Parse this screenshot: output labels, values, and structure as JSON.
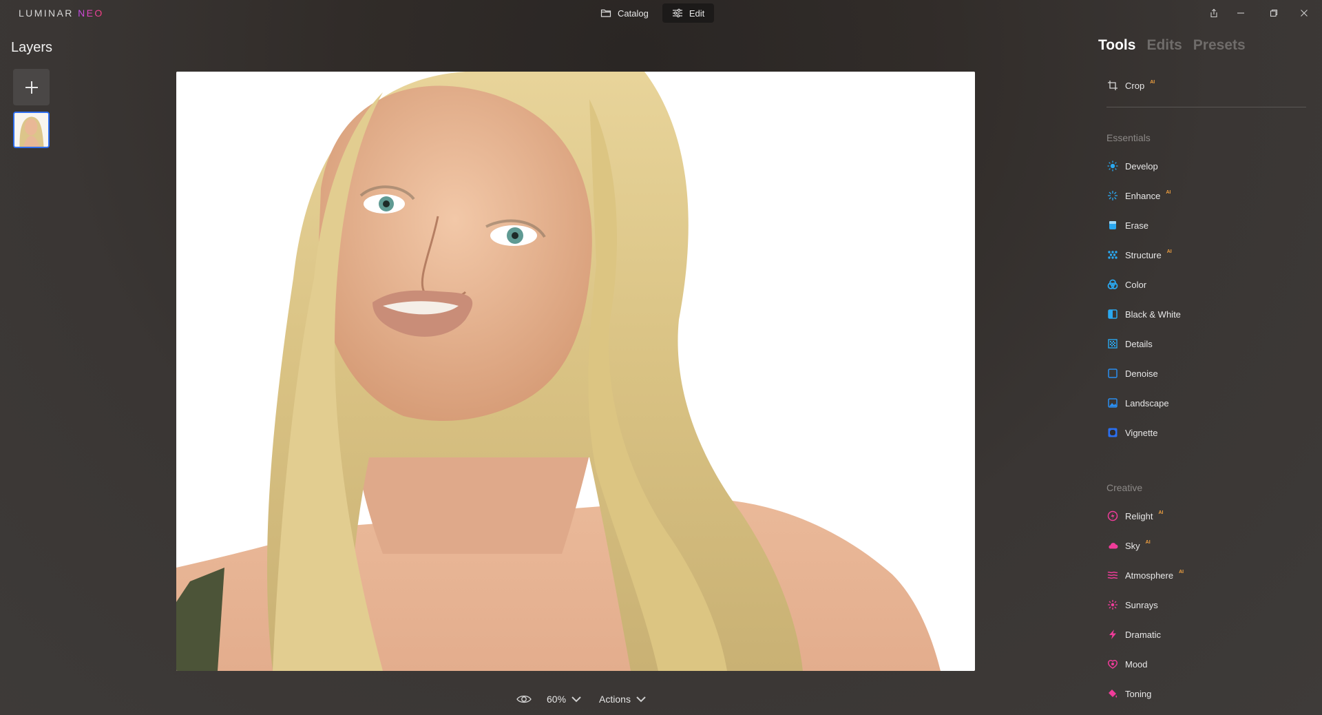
{
  "app": {
    "logo_main": "LUMINAR ",
    "logo_accent": "NEO"
  },
  "modes": {
    "catalog_label": "Catalog",
    "edit_label": "Edit",
    "active": "Edit"
  },
  "layers": {
    "title": "Layers"
  },
  "bottom_bar": {
    "zoom": "60%",
    "actions_label": "Actions"
  },
  "panel": {
    "tabs": [
      "Tools",
      "Edits",
      "Presets"
    ],
    "active_tab": "Tools",
    "crop": {
      "label": "Crop",
      "badge": "AI"
    },
    "essentials_label": "Essentials",
    "essentials": [
      {
        "label": "Develop",
        "badge": "",
        "icon": "develop-sun-icon"
      },
      {
        "label": "Enhance",
        "badge": "AI",
        "icon": "enhance-sparkle-icon"
      },
      {
        "label": "Erase",
        "badge": "",
        "icon": "eraser-icon"
      },
      {
        "label": "Structure",
        "badge": "AI",
        "icon": "structure-dots-icon"
      },
      {
        "label": "Color",
        "badge": "",
        "icon": "color-circles-icon"
      },
      {
        "label": "Black & White",
        "badge": "",
        "icon": "black-white-icon"
      },
      {
        "label": "Details",
        "badge": "",
        "icon": "details-grid-icon"
      },
      {
        "label": "Denoise",
        "badge": "",
        "icon": "denoise-square-icon"
      },
      {
        "label": "Landscape",
        "badge": "",
        "icon": "landscape-image-icon"
      },
      {
        "label": "Vignette",
        "badge": "",
        "icon": "vignette-icon"
      }
    ],
    "creative_label": "Creative",
    "creative": [
      {
        "label": "Relight",
        "badge": "AI",
        "icon": "relight-bolt-icon"
      },
      {
        "label": "Sky",
        "badge": "AI",
        "icon": "sky-cloud-icon"
      },
      {
        "label": "Atmosphere",
        "badge": "AI",
        "icon": "atmosphere-waves-icon"
      },
      {
        "label": "Sunrays",
        "badge": "",
        "icon": "sunrays-icon"
      },
      {
        "label": "Dramatic",
        "badge": "",
        "icon": "dramatic-bolt-icon"
      },
      {
        "label": "Mood",
        "badge": "",
        "icon": "mood-icon"
      },
      {
        "label": "Toning",
        "badge": "",
        "icon": "toning-bucket-icon"
      }
    ]
  },
  "colors": {
    "essentials_icon": "#2aa8f0",
    "creative_icon": "#f03c9a",
    "ai_badge": "#f0a040",
    "layer_selected_border": "#2f6ff0"
  }
}
